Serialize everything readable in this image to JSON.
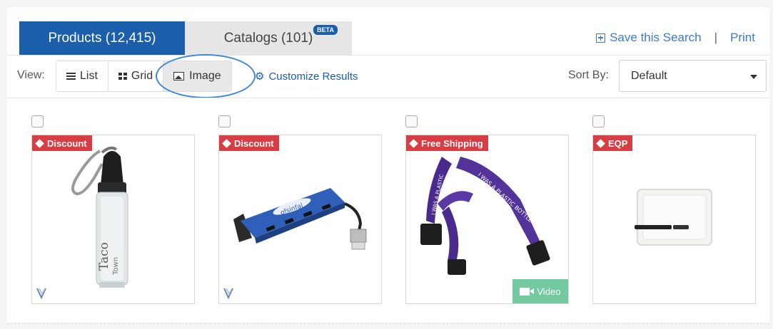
{
  "tabs": {
    "products_label": "Products (12,415)",
    "catalogs_label": "Catalogs (101)",
    "beta_badge": "BETA"
  },
  "links": {
    "save_search": "Save this Search",
    "separator": "|",
    "print": "Print"
  },
  "view": {
    "label": "View:",
    "options": [
      "List",
      "Grid",
      "Image"
    ],
    "selected": "Image",
    "customize": "Customize Results"
  },
  "sort": {
    "label": "Sort By:",
    "value": "Default"
  },
  "products": [
    {
      "badge": "Discount",
      "badge_color": "#d83d44",
      "image": "water-bottle-carabiner",
      "has_v_icon": true,
      "has_video": false
    },
    {
      "badge": "Discount",
      "badge_color": "#d83d44",
      "image": "usb-hub-blue",
      "has_v_icon": true,
      "has_video": false
    },
    {
      "badge": "Free Shipping",
      "badge_color": "#d83d44",
      "image": "purple-lanyard",
      "has_v_icon": false,
      "has_video": true,
      "video_label": "Video"
    },
    {
      "badge": "EQP",
      "badge_color": "#d83d44",
      "image": "clear-badge-holder",
      "has_v_icon": false,
      "has_video": false
    }
  ],
  "colors": {
    "accent": "#1b5eab",
    "link": "#3a7bc8",
    "badge": "#d83d44",
    "video": "#73c9a0"
  }
}
